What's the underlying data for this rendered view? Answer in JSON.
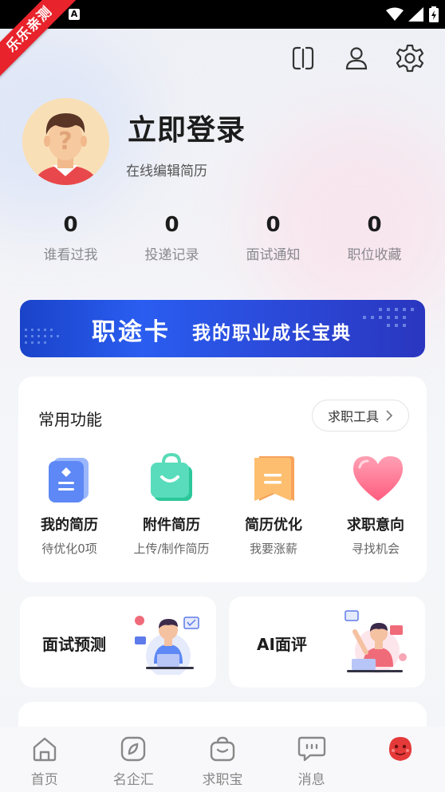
{
  "status_bar": {
    "notification_icon": "A",
    "ribbon_text": "乐乐亲测"
  },
  "top_icons": [
    "scan-icon",
    "user-icon",
    "settings-icon"
  ],
  "profile": {
    "login_title": "立即登录",
    "subtitle": "在线编辑简历"
  },
  "stats": [
    {
      "value": "0",
      "label": "谁看过我"
    },
    {
      "value": "0",
      "label": "投递记录"
    },
    {
      "value": "0",
      "label": "面试通知"
    },
    {
      "value": "0",
      "label": "职位收藏"
    }
  ],
  "banner": {
    "title": "职途卡",
    "subtitle": "我的职业成长宝典"
  },
  "functions": {
    "title": "常用功能",
    "tools_button": "求职工具",
    "items": [
      {
        "label": "我的简历",
        "desc": "待优化0项",
        "icon": "resume-icon"
      },
      {
        "label": "附件简历",
        "desc": "上传/制作简历",
        "icon": "attachment-icon"
      },
      {
        "label": "简历优化",
        "desc": "我要涨薪",
        "icon": "optimize-icon"
      },
      {
        "label": "求职意向",
        "desc": "寻找机会",
        "icon": "heart-icon"
      }
    ]
  },
  "mini_cards": [
    {
      "label": "面试预测"
    },
    {
      "label": "AI面评"
    }
  ],
  "bottom_nav": [
    {
      "label": "首页",
      "icon": "home-icon"
    },
    {
      "label": "名企汇",
      "icon": "compass-icon"
    },
    {
      "label": "求职宝",
      "icon": "bag-icon"
    },
    {
      "label": "消息",
      "icon": "message-icon"
    },
    {
      "label": "",
      "icon": "mascot-icon"
    }
  ],
  "colors": {
    "accent_blue": "#2a5df0",
    "ribbon_red": "#e8232b",
    "mascot_red": "#e53a3a"
  }
}
